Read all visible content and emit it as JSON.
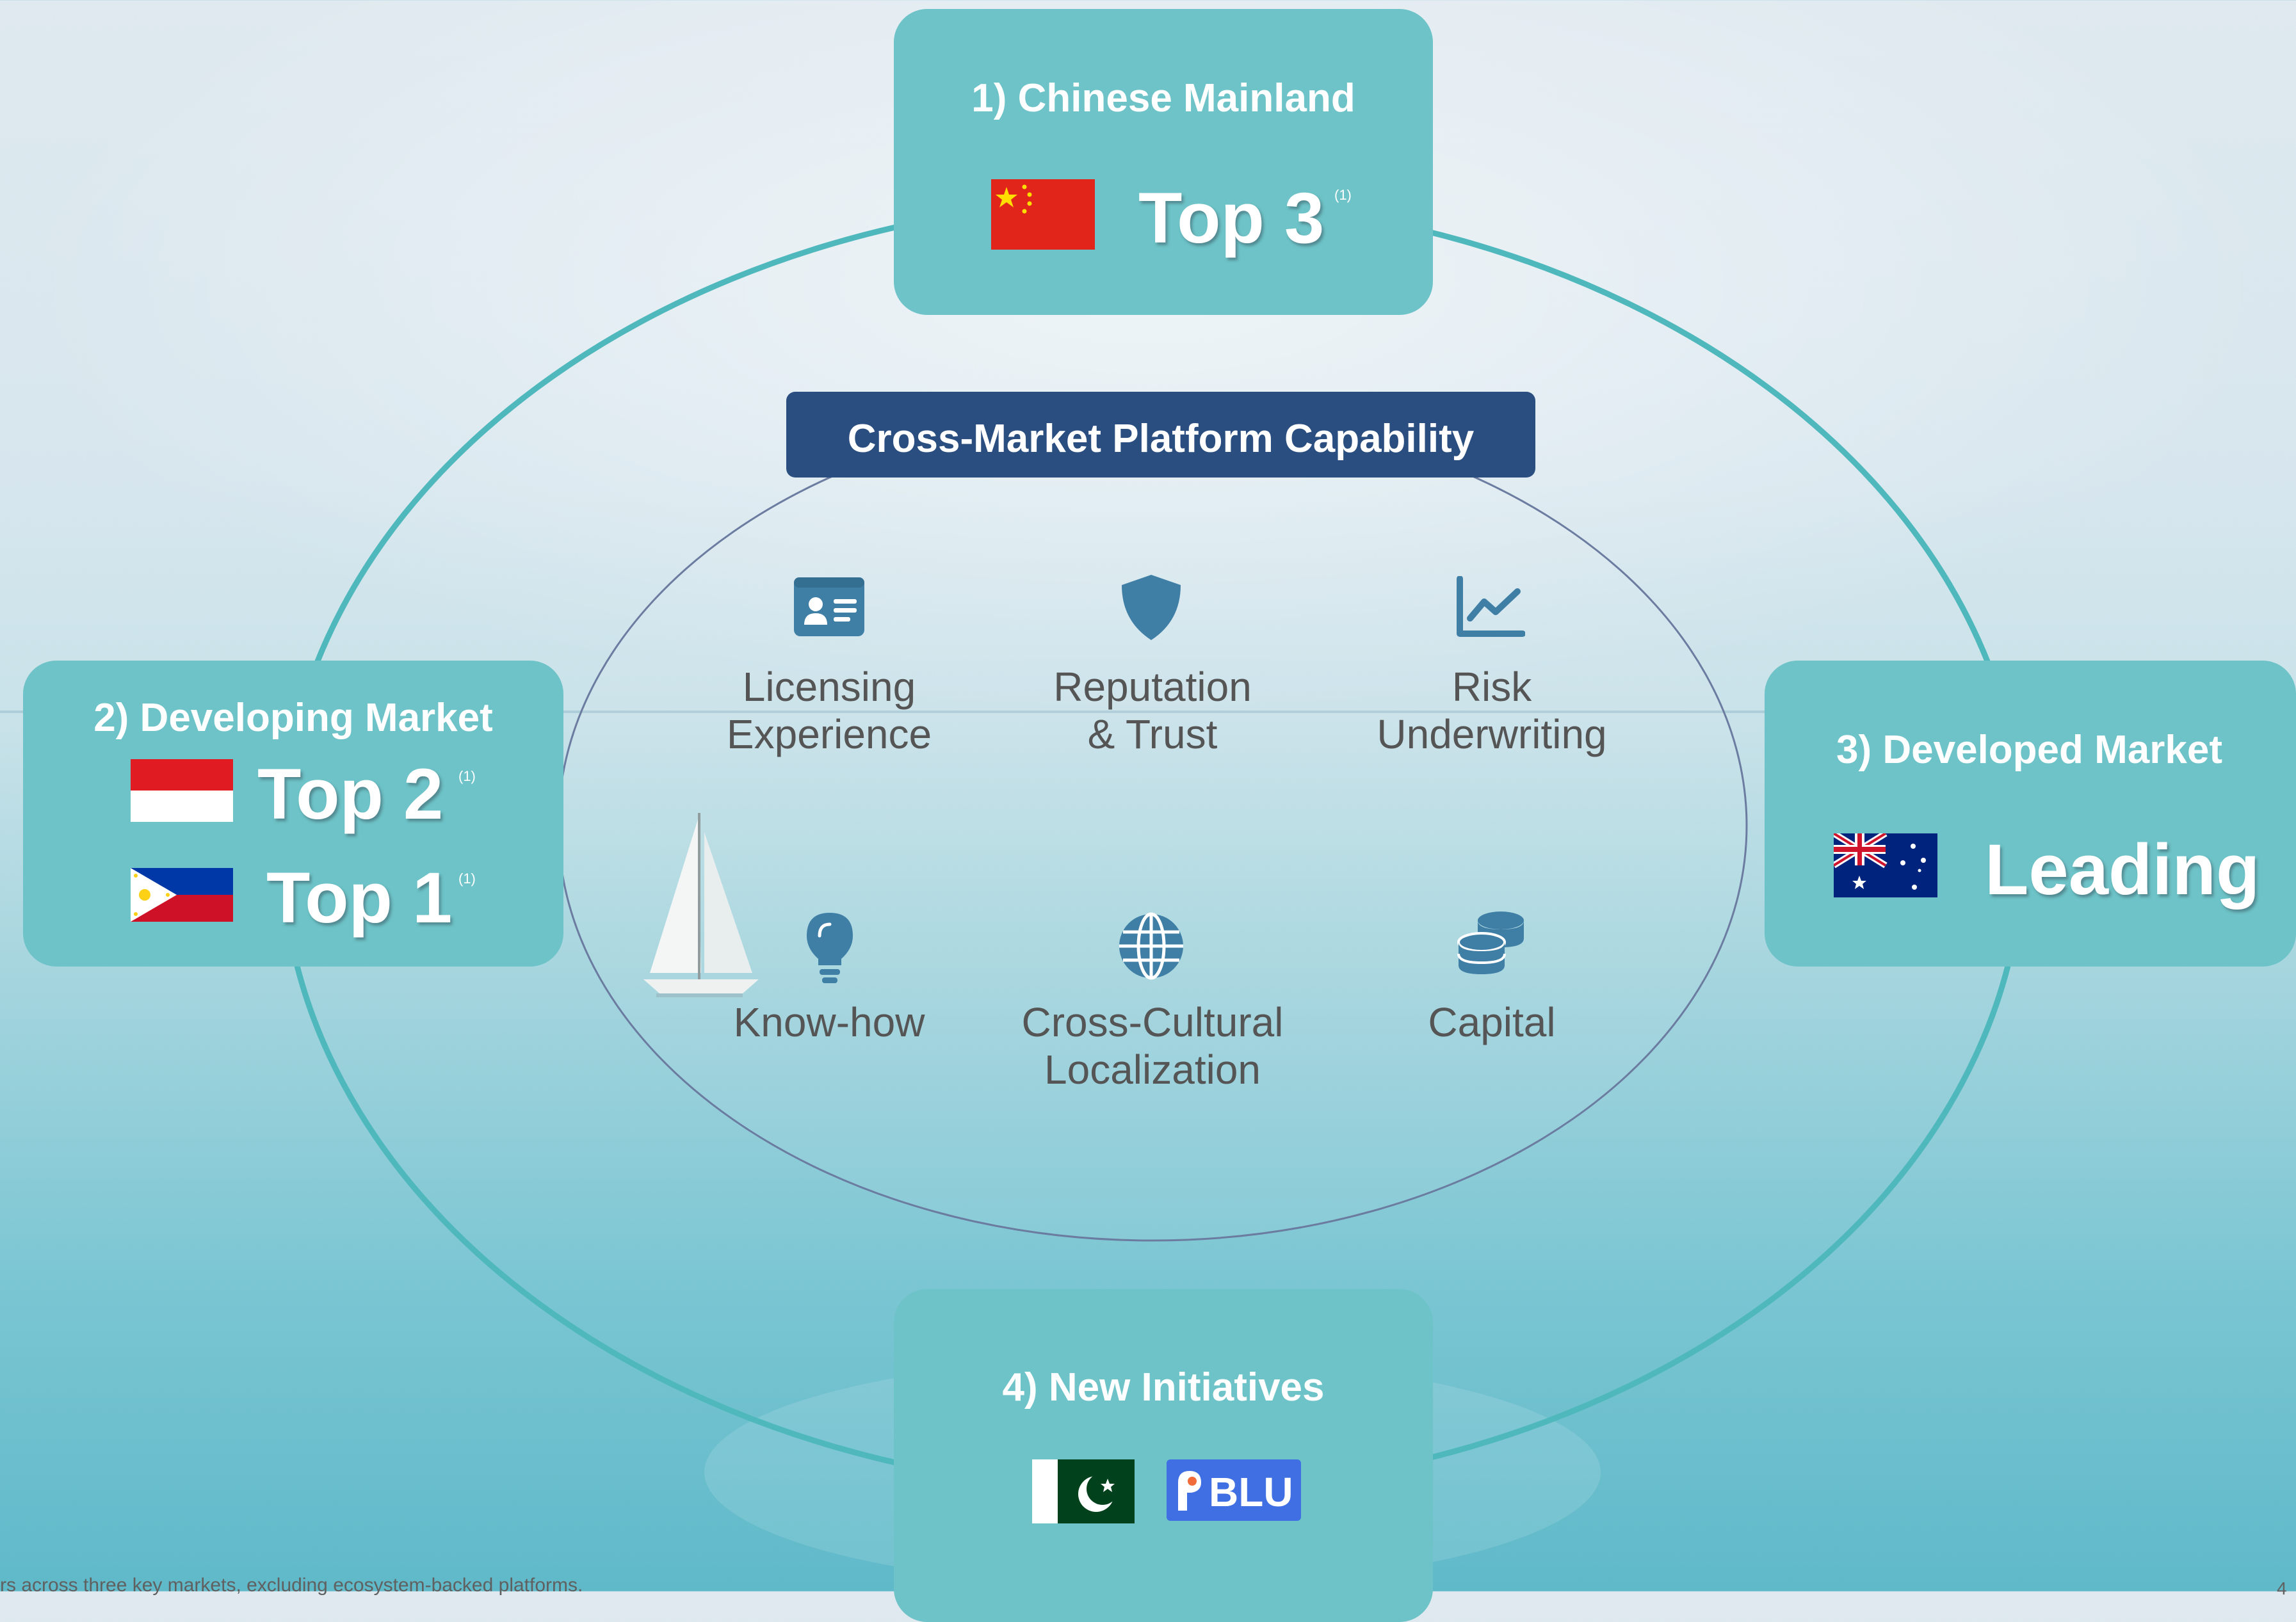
{
  "markets": {
    "china": {
      "title": "1) Chinese Mainland",
      "rank": "Top 3",
      "note": "(1)"
    },
    "developing": {
      "title": "2) Developing Market",
      "rank_1": "Top 2",
      "note_1": "(1)",
      "rank_2": "Top 1",
      "note_2": "(1)"
    },
    "developed": {
      "title": "3) Developed Market",
      "rank": "Leading"
    },
    "new": {
      "title": "4) New Initiatives",
      "logo_text": "BLU"
    }
  },
  "capability": {
    "title": "Cross-Market Platform Capability",
    "items": [
      {
        "label": "Licensing\nExperience",
        "icon": "id-card-icon"
      },
      {
        "label": "Reputation\n& Trust",
        "icon": "shield-icon"
      },
      {
        "label": "Risk\nUnderwriting",
        "icon": "line-chart-icon"
      },
      {
        "label": "Know-how",
        "icon": "lightbulb-icon"
      },
      {
        "label": "Cross-Cultural\nLocalization",
        "icon": "globe-icon"
      },
      {
        "label": "Capital",
        "icon": "coins-icon"
      }
    ]
  },
  "footnote": "rs across three key markets, excluding ecosystem-backed platforms.",
  "page_number": "4",
  "colors": {
    "box": "#6dc3c7",
    "header": "#2a4e80",
    "ring": "#4fb8bd",
    "icon": "#3f7fa6"
  }
}
